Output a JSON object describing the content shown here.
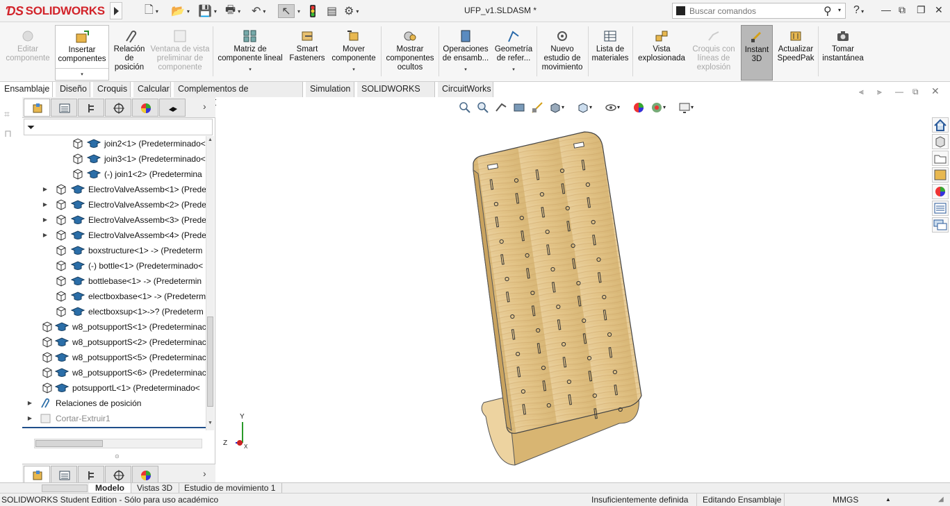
{
  "app": {
    "brand": "SOLIDWORKS",
    "doc_title": "UFP_v1.SLDASM *"
  },
  "search": {
    "placeholder": "Buscar comandos"
  },
  "commands": [
    {
      "label": "Editar componente",
      "disabled": true
    },
    {
      "label": "Insertar componentes",
      "disabled": false
    },
    {
      "label": "Relación de posición",
      "disabled": false
    },
    {
      "label": "Ventana de vista preliminar de componente",
      "disabled": true
    },
    {
      "label": "Matriz de componente lineal",
      "disabled": false
    },
    {
      "label": "Smart Fasteners",
      "disabled": false
    },
    {
      "label": "Mover componente",
      "disabled": false
    },
    {
      "label": "Mostrar componentes ocultos",
      "disabled": false
    },
    {
      "label": "Operaciones de ensamb...",
      "disabled": false
    },
    {
      "label": "Geometría de refer...",
      "disabled": false
    },
    {
      "label": "Nuevo estudio de movimiento",
      "disabled": false
    },
    {
      "label": "Lista de materiales",
      "disabled": false
    },
    {
      "label": "Vista explosionada",
      "disabled": false
    },
    {
      "label": "Croquis con líneas de explosión",
      "disabled": true
    },
    {
      "label": "Instant 3D",
      "disabled": false,
      "active": true
    },
    {
      "label": "Actualizar SpeedPak",
      "disabled": false
    },
    {
      "label": "Tomar instantánea",
      "disabled": false
    }
  ],
  "tabs": [
    "Ensamblaje",
    "Diseño",
    "Croquis",
    "Calcular",
    "Complementos de SOLIDWORKS",
    "Simulation",
    "SOLIDWORKS MBD",
    "CircuitWorks"
  ],
  "tree": [
    {
      "label": "join2<1> (Predeterminado<",
      "level": 2
    },
    {
      "label": "join3<1> (Predeterminado<",
      "level": 2
    },
    {
      "label": "(-) join1<2> (Predetermina",
      "level": 2
    },
    {
      "label": "ElectroValveAssemb<1> (Prede",
      "level": 1,
      "expandable": true
    },
    {
      "label": "ElectroValveAssemb<2> (Prede",
      "level": 1,
      "expandable": true
    },
    {
      "label": "ElectroValveAssemb<3> (Prede",
      "level": 1,
      "expandable": true
    },
    {
      "label": "ElectroValveAssemb<4> (Prede",
      "level": 1,
      "expandable": true
    },
    {
      "label": "boxstructure<1> -> (Predeterm",
      "level": 1
    },
    {
      "label": "(-) bottle<1> (Predeterminado<",
      "level": 1
    },
    {
      "label": "bottlebase<1> -> (Predetermin",
      "level": 1
    },
    {
      "label": "electboxbase<1> -> (Predeterm",
      "level": 1
    },
    {
      "label": "electboxsup<1>->? (Predeterm",
      "level": 1
    },
    {
      "label": "w8_potsupportS<1> (Predeterminac",
      "level": 0
    },
    {
      "label": "w8_potsupportS<2> (Predeterminac",
      "level": 0
    },
    {
      "label": "w8_potsupportS<5> (Predeterminac",
      "level": 0
    },
    {
      "label": "w8_potsupportS<6> (Predeterminac",
      "level": 0
    },
    {
      "label": "potsupportL<1> (Predeterminado<",
      "level": 0
    },
    {
      "label": "Relaciones de posición",
      "level": -1,
      "expandable": true
    },
    {
      "label": "Cortar-Extruir1",
      "level": -1,
      "expandable": true,
      "grey": true
    }
  ],
  "bottom_tabs": [
    "Modelo",
    "Vistas 3D",
    "Estudio de movimiento 1"
  ],
  "status": {
    "edition": "SOLIDWORKS Student Edition - Sólo para uso académico",
    "definition": "Insuficientemente definida",
    "mode": "Editando Ensamblaje",
    "units": "MMGS"
  },
  "triad": {
    "x": "X",
    "y": "Y",
    "z": "Z"
  },
  "colors": {
    "brand_red": "#d2232a",
    "wood": "#e6c78f",
    "active_cmd": "#b8b8b8"
  }
}
